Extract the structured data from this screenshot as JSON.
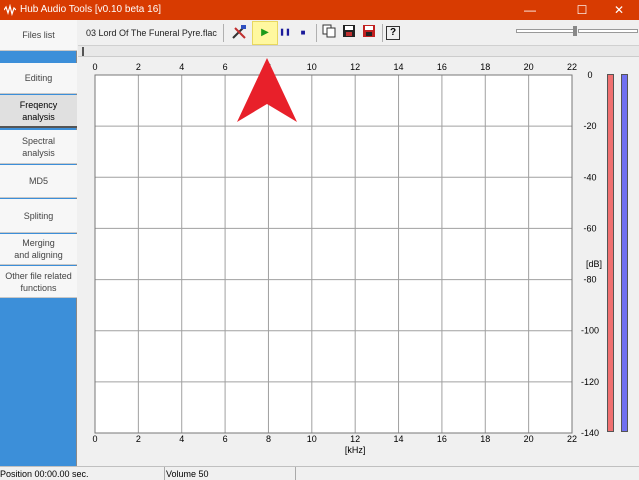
{
  "window": {
    "title": "Hub Audio Tools [v0.10 beta 16]",
    "minimize_glyph": "—",
    "maximize_glyph": "☐",
    "close_glyph": "✕"
  },
  "sidebar": {
    "items": [
      {
        "label": "Files list"
      },
      {
        "label": "Editing"
      },
      {
        "label": "Freqency\nanalysis"
      },
      {
        "label": "Spectral\nanalysis"
      },
      {
        "label": "MD5"
      },
      {
        "label": "Spliting"
      },
      {
        "label": "Merging\nand aligning"
      },
      {
        "label": "Other file related\nfunctions"
      }
    ],
    "active_index": 2
  },
  "toolbar": {
    "file_name": "03 Lord Of The Funeral Pyre.flac",
    "icons": [
      "tools-icon",
      "play-icon",
      "pause-icon",
      "stop-icon",
      "copy-icon",
      "save-icon",
      "save-red-icon",
      "help-icon"
    ],
    "play_glyph": "▶",
    "pause_glyph": "❚❚",
    "stop_glyph": "■",
    "help_glyph": "?"
  },
  "chart_data": {
    "type": "line",
    "x_ticks": [
      "0",
      "2",
      "4",
      "6",
      "8",
      "10",
      "12",
      "14",
      "16",
      "18",
      "20",
      "22"
    ],
    "y_ticks": [
      "0",
      "-20",
      "-40",
      "-60",
      "-80",
      "-100",
      "-120",
      "-140"
    ],
    "xlabel": "[kHz]",
    "ylabel": "[dB]",
    "xlim": [
      0,
      22
    ],
    "ylim": [
      -140,
      0
    ],
    "grid": true,
    "series": []
  },
  "meters": {
    "left_color": "#f07070",
    "right_color": "#7070f0"
  },
  "status": {
    "position": "Position 00:00.00 sec.",
    "volume": "Volume 50"
  },
  "colors": {
    "titlebar": "#d83b01",
    "sidebar_bg": "#3c8fd9",
    "annotation_arrow": "#e8202a",
    "play_highlight": "#fff8a0"
  }
}
